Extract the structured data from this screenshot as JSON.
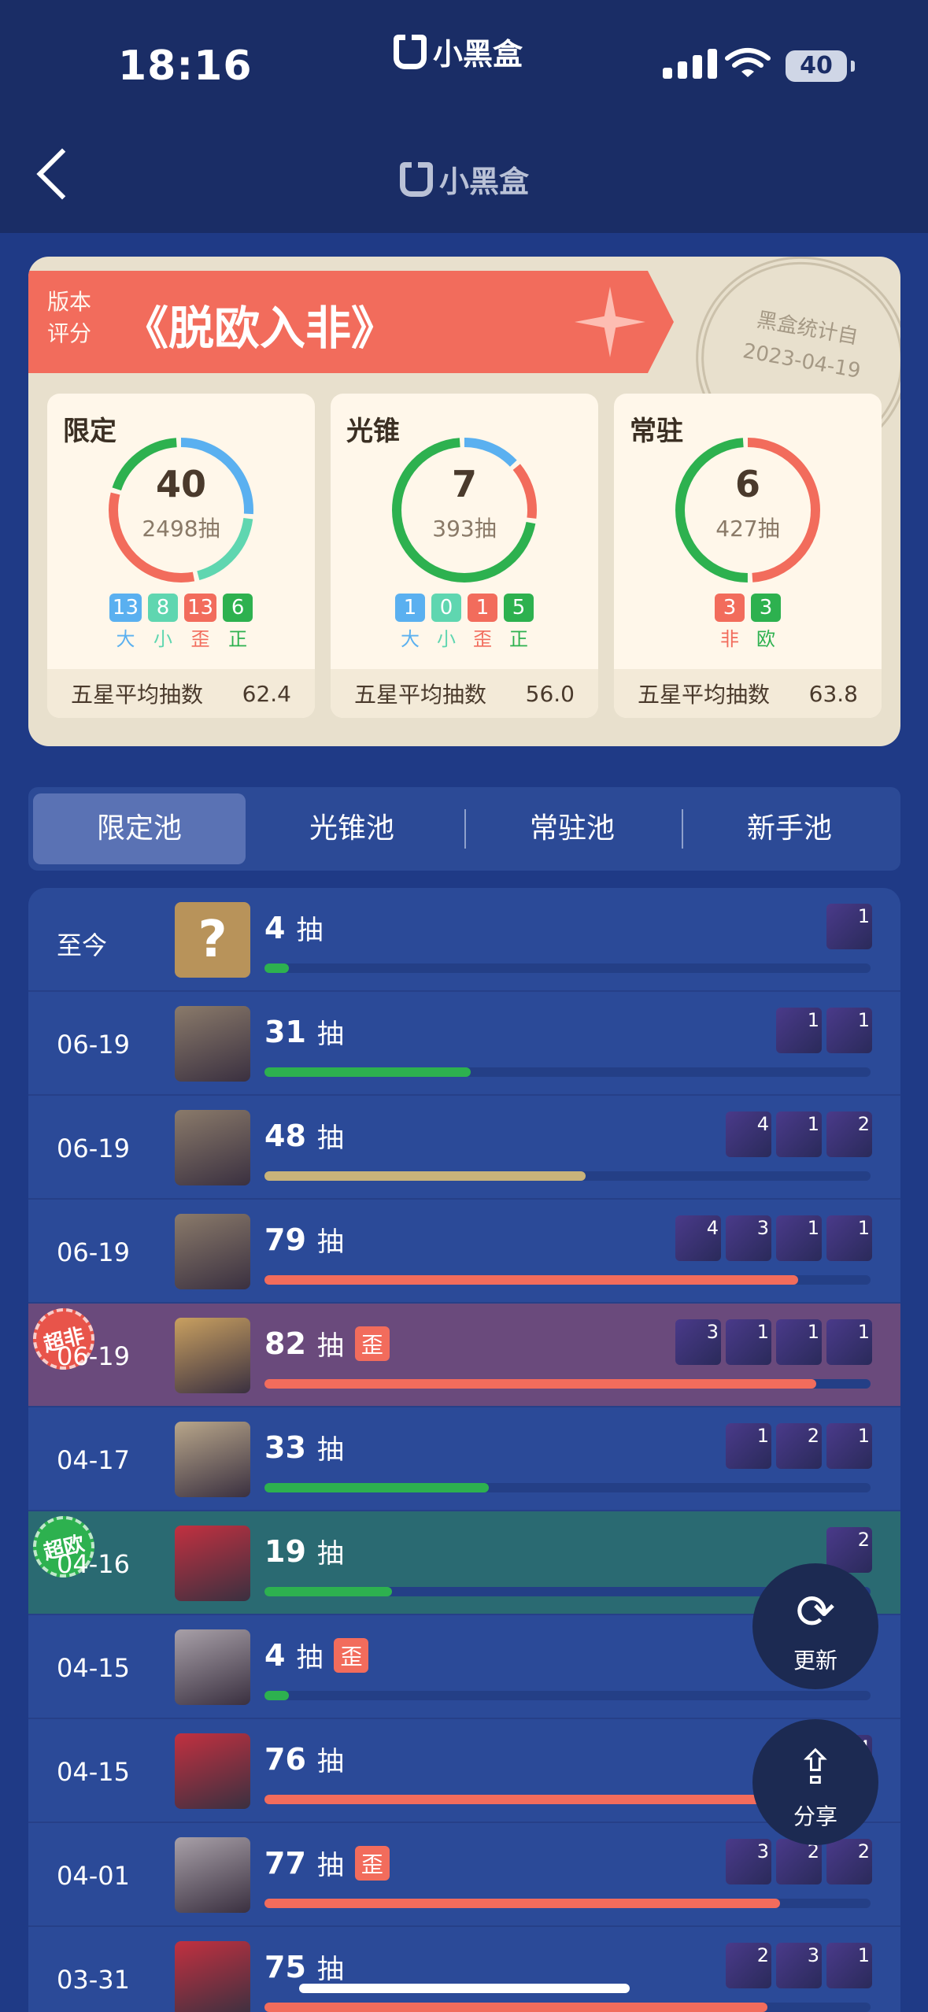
{
  "status": {
    "time": "18:16",
    "app_name": "小黑盒",
    "battery": "40"
  },
  "nav": {
    "title": "小黑盒"
  },
  "rating": {
    "small_label_1": "版本",
    "small_label_2": "评分",
    "title": "《脱欧入非》",
    "stamp_line1": "黑盒统计自",
    "stamp_line2": "2023-04-19"
  },
  "pools": [
    {
      "name": "限定",
      "count": "40",
      "pulls": "2498抽",
      "badges": [
        {
          "n": "13",
          "l": "大",
          "color": "#5ab0f0"
        },
        {
          "n": "8",
          "l": "小",
          "color": "#5fd6b0"
        },
        {
          "n": "13",
          "l": "歪",
          "color": "#f26c5c"
        },
        {
          "n": "6",
          "l": "正",
          "color": "#2db14f"
        }
      ],
      "avg_label": "五星平均抽数",
      "avg": "62.4"
    },
    {
      "name": "光锥",
      "count": "7",
      "pulls": "393抽",
      "badges": [
        {
          "n": "1",
          "l": "大",
          "color": "#5ab0f0"
        },
        {
          "n": "0",
          "l": "小",
          "color": "#5fd6b0"
        },
        {
          "n": "1",
          "l": "歪",
          "color": "#f26c5c"
        },
        {
          "n": "5",
          "l": "正",
          "color": "#2db14f"
        }
      ],
      "avg_label": "五星平均抽数",
      "avg": "56.0"
    },
    {
      "name": "常驻",
      "count": "6",
      "pulls": "427抽",
      "badges": [
        {
          "n": "3",
          "l": "非",
          "color": "#f26c5c"
        },
        {
          "n": "3",
          "l": "欧",
          "color": "#2db14f"
        }
      ],
      "avg_label": "五星平均抽数",
      "avg": "63.8"
    }
  ],
  "tabs": [
    "限定池",
    "光锥池",
    "常驻池",
    "新手池"
  ],
  "rows": [
    {
      "date": "至今",
      "pulls": "4",
      "unit": "抽",
      "wai": "",
      "progress": 0.04,
      "bar": "#2db14f",
      "tag": "",
      "minis": [
        "1"
      ]
    },
    {
      "date": "06-19",
      "pulls": "31",
      "unit": "抽",
      "wai": "",
      "progress": 0.34,
      "bar": "#2db14f",
      "tag": "",
      "minis": [
        "1",
        "1"
      ]
    },
    {
      "date": "06-19",
      "pulls": "48",
      "unit": "抽",
      "wai": "",
      "progress": 0.53,
      "bar": "#c9b37a",
      "tag": "",
      "minis": [
        "4",
        "1",
        "2"
      ]
    },
    {
      "date": "06-19",
      "pulls": "79",
      "unit": "抽",
      "wai": "",
      "progress": 0.88,
      "bar": "#f26c5c",
      "tag": "",
      "minis": [
        "4",
        "3",
        "1",
        "1"
      ]
    },
    {
      "date": "06-19",
      "pulls": "82",
      "unit": "抽",
      "wai": "歪",
      "progress": 0.91,
      "bar": "#f26c5c",
      "tag": "超非",
      "minis": [
        "3",
        "1",
        "1",
        "1"
      ]
    },
    {
      "date": "04-17",
      "pulls": "33",
      "unit": "抽",
      "wai": "",
      "progress": 0.37,
      "bar": "#2db14f",
      "tag": "",
      "minis": [
        "1",
        "2",
        "1"
      ]
    },
    {
      "date": "04-16",
      "pulls": "19",
      "unit": "抽",
      "wai": "",
      "progress": 0.21,
      "bar": "#2db14f",
      "tag": "超欧",
      "minis": [
        "2"
      ]
    },
    {
      "date": "04-15",
      "pulls": "4",
      "unit": "抽",
      "wai": "歪",
      "progress": 0.04,
      "bar": "#2db14f",
      "tag": "",
      "minis": []
    },
    {
      "date": "04-15",
      "pulls": "76",
      "unit": "抽",
      "wai": "",
      "progress": 0.84,
      "bar": "#f26c5c",
      "tag": "",
      "minis": [
        "4"
      ]
    },
    {
      "date": "04-01",
      "pulls": "77",
      "unit": "抽",
      "wai": "歪",
      "progress": 0.85,
      "bar": "#f26c5c",
      "tag": "",
      "minis": [
        "3",
        "2",
        "2"
      ]
    },
    {
      "date": "03-31",
      "pulls": "75",
      "unit": "抽",
      "wai": "",
      "progress": 0.83,
      "bar": "#f26c5c",
      "tag": "",
      "minis": [
        "2",
        "3",
        "1"
      ]
    }
  ],
  "fab": {
    "refresh": "更新",
    "share": "分享"
  }
}
